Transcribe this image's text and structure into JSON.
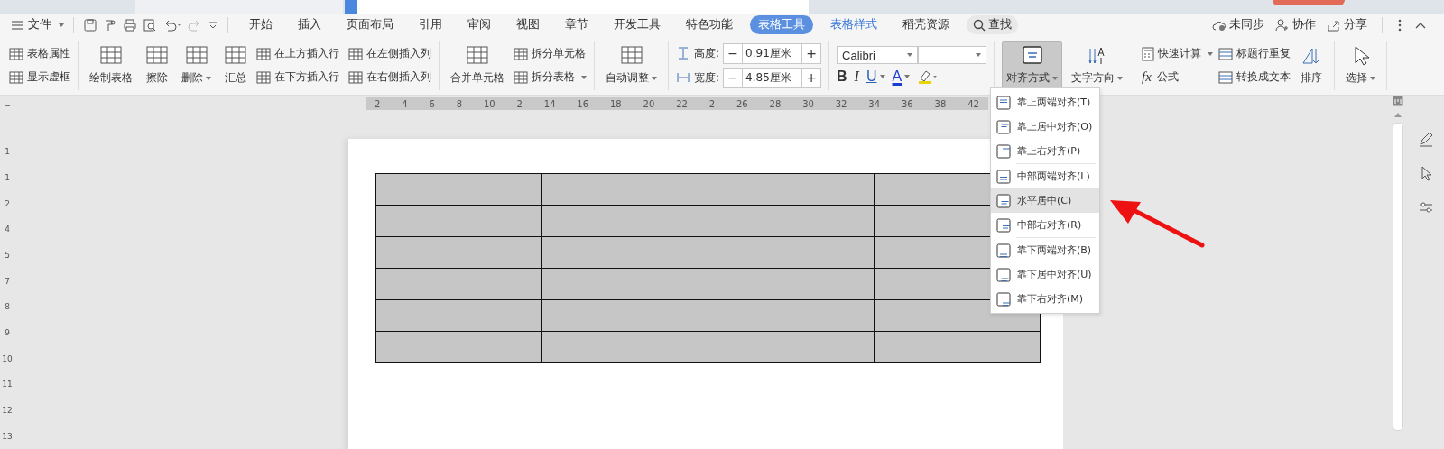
{
  "menu_bar": {
    "file_menu": "文件",
    "tabs": [
      {
        "label": "开始",
        "kind": "normal",
        "selected": false
      },
      {
        "label": "插入",
        "kind": "normal",
        "selected": false
      },
      {
        "label": "页面布局",
        "kind": "normal",
        "selected": false
      },
      {
        "label": "引用",
        "kind": "normal",
        "selected": false
      },
      {
        "label": "审阅",
        "kind": "normal",
        "selected": false
      },
      {
        "label": "视图",
        "kind": "normal",
        "selected": false
      },
      {
        "label": "章节",
        "kind": "normal",
        "selected": false
      },
      {
        "label": "开发工具",
        "kind": "normal",
        "selected": false
      },
      {
        "label": "特色功能",
        "kind": "normal",
        "selected": false
      },
      {
        "label": "表格工具",
        "kind": "context",
        "selected": true
      },
      {
        "label": "表格样式",
        "kind": "context",
        "selected": false
      },
      {
        "label": "稻壳资源",
        "kind": "normal",
        "selected": false
      }
    ],
    "search": "查找",
    "actions": [
      "未同步",
      "协作",
      "分享"
    ]
  },
  "ribbon": {
    "groups": [
      {
        "items": [
          {
            "label": "表格属性",
            "kind": "small"
          },
          {
            "label": "显示虚框",
            "kind": "small"
          }
        ]
      },
      {
        "items": [
          {
            "label": "绘制表格",
            "kind": "large"
          },
          {
            "label": "擦除",
            "kind": "large"
          },
          {
            "label": "删除",
            "kind": "large",
            "dropdown": true
          },
          {
            "label": "汇总",
            "kind": "large"
          },
          {
            "label": "在上方插入行",
            "kind": "small"
          },
          {
            "label": "在下方插入行",
            "kind": "small"
          },
          {
            "label": "在左侧插入列",
            "kind": "small"
          },
          {
            "label": "在右侧插入列",
            "kind": "small"
          }
        ]
      },
      {
        "items": [
          {
            "label": "合并单元格",
            "kind": "large"
          },
          {
            "label": "拆分单元格",
            "kind": "small"
          },
          {
            "label": "拆分表格",
            "kind": "small",
            "dropdown": true
          }
        ]
      },
      {
        "items": [
          {
            "label": "自动调整",
            "kind": "large",
            "dropdown": true
          }
        ]
      }
    ],
    "size_fields": [
      {
        "label": "高度:",
        "minus": "−",
        "value": "0.91厘米",
        "plus": "+"
      },
      {
        "label": "宽度:",
        "minus": "−",
        "value": "4.85厘米",
        "plus": "+"
      }
    ],
    "font": {
      "family": "Calibri",
      "format_buttons": [
        "B",
        "I",
        "U",
        "A"
      ]
    },
    "align_button": {
      "label": "对齐方式",
      "pressed": true
    },
    "text_direction": {
      "label": "文字方向"
    },
    "calc": [
      {
        "label": "快速计算",
        "dropdown": true
      },
      {
        "label": "公式",
        "prefix": "fx"
      }
    ],
    "convert": [
      {
        "label": "标题行重复"
      },
      {
        "label": "转换成文本"
      }
    ],
    "sort": "排序",
    "select": "选择"
  },
  "ruler": {
    "labels": [
      "2",
      "4",
      "6",
      "8",
      "10",
      "2",
      "14",
      "16",
      "18",
      "20",
      "22",
      "2",
      "26",
      "28",
      "30",
      "32",
      "34",
      "36",
      "38",
      "42"
    ],
    "vertical_labels": [
      "1",
      "1",
      "2",
      "4",
      "5",
      "7",
      "8",
      "9",
      "10",
      "11",
      "12",
      "13"
    ]
  },
  "align_menu": {
    "items": [
      {
        "label": "靠上两端对齐(T)",
        "selected": false
      },
      {
        "label": "靠上居中对齐(O)",
        "selected": false
      },
      {
        "label": "靠上右对齐(P)",
        "selected": false
      },
      {
        "label": "中部两端对齐(L)",
        "selected": false
      },
      {
        "label": "水平居中(C)",
        "selected": true
      },
      {
        "label": "中部右对齐(R)",
        "selected": false
      },
      {
        "label": "靠下两端对齐(B)",
        "selected": false
      },
      {
        "label": "靠下居中对齐(U)",
        "selected": false
      },
      {
        "label": "靠下右对齐(M)",
        "selected": false
      }
    ]
  }
}
